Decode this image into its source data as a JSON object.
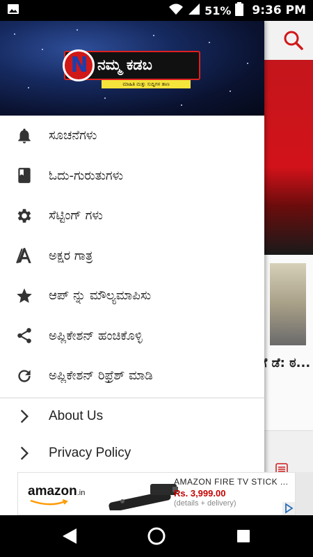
{
  "status_bar": {
    "battery_percent": "51%",
    "time": "9:36 PM",
    "icons": [
      "image-icon",
      "wifi-icon",
      "signal-icon",
      "battery-icon"
    ]
  },
  "drawer": {
    "logo": {
      "title": "ನಮ್ಮ ಕಡಬ",
      "letter": "N",
      "tagline": "ಮಾಹಿತಿ ಮತ್ತು ಸುದ್ದಿಗಳ ತಾಣ"
    },
    "items": [
      {
        "icon": "bell-icon",
        "label": "ಸೂಚನೆಗಳು"
      },
      {
        "icon": "book-icon",
        "label": "ಓದು-ಗುರುತುಗಳು"
      },
      {
        "icon": "gear-icon",
        "label": "ಸೆಟ್ಟಿಂಗ್ ಗಳು"
      },
      {
        "icon": "font-size-icon",
        "label": "ಅಕ್ಷರ ಗಾತ್ರ"
      },
      {
        "icon": "star-icon",
        "label": "ಆಪ್ ನ್ನು ಮೌಲ್ಯಮಾಪಿಸು"
      },
      {
        "icon": "share-icon",
        "label": "ಅಪ್ಲಿಕೇಶನ್ ಹಂಚಿಕೊಳ್ಳಿ"
      },
      {
        "icon": "refresh-icon",
        "label": "ಅಪ್ಲಿಕೇಶನ್ ರಿಫ್ರೆಶ್ ಮಾಡಿ"
      }
    ],
    "links": [
      {
        "icon": "chevron-right-icon",
        "label": "About Us"
      },
      {
        "icon": "chevron-right-icon",
        "label": "Privacy Policy"
      }
    ]
  },
  "background": {
    "headline_fragment": "ಟಿಗೆ ಡೆ: ಠ..."
  },
  "ad": {
    "brand": "amazon",
    "brand_suffix": ".in",
    "title": "AMAZON FIRE TV STICK ...",
    "price": "Rs. 3,999.00",
    "details": "(details + delivery)"
  },
  "colors": {
    "accent_red": "#d01818",
    "menu_text": "#222222",
    "price_red": "#c40000"
  }
}
